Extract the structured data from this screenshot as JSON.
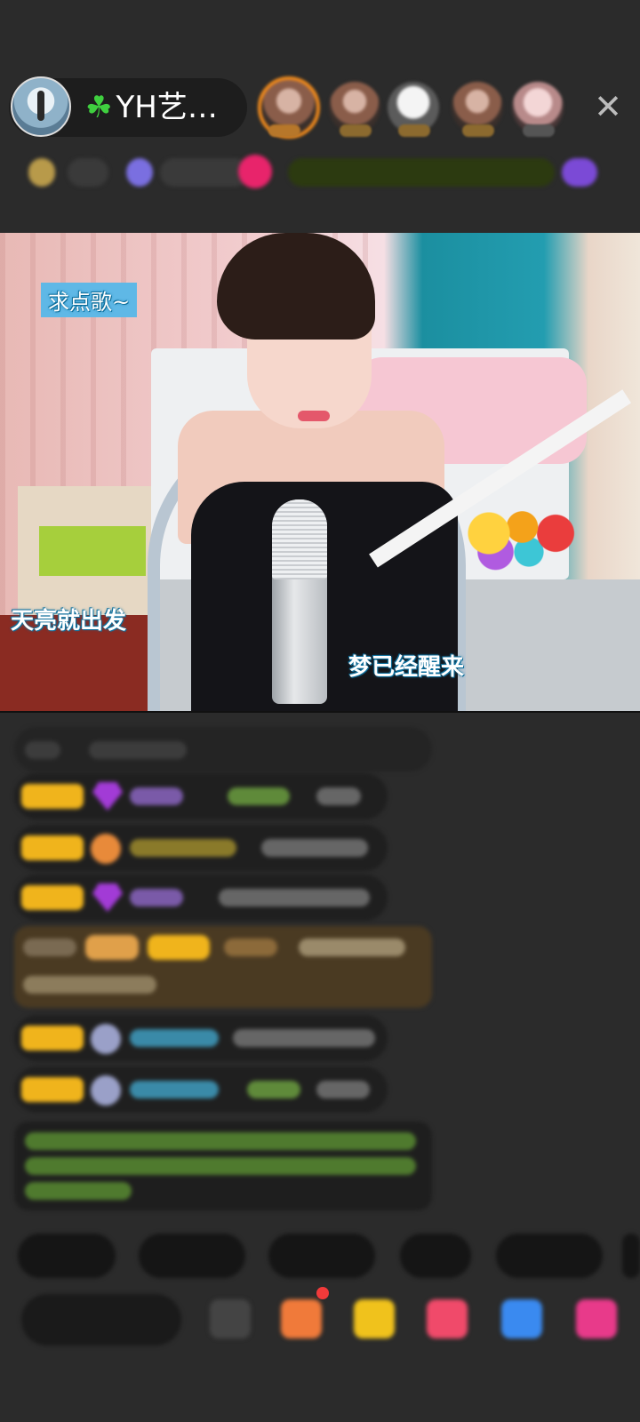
{
  "header": {
    "host_name": "YH艺…",
    "host_prefix_icon": "clover-icon",
    "close_icon": "close-icon",
    "viewer_count": 5,
    "accent": "#f08a1c"
  },
  "video": {
    "caption_top_left": "求点歌~",
    "lyric_left": "天亮就出发",
    "lyric_right": "梦已经醒来",
    "caption_color": "#5fb8e6"
  },
  "chat": {
    "badge_color": "#f0b41c",
    "highlight_color": "#4a3a22",
    "message_count": 8
  },
  "bottom": {
    "quick_reply_count": 5,
    "action_icon_count": 6
  }
}
